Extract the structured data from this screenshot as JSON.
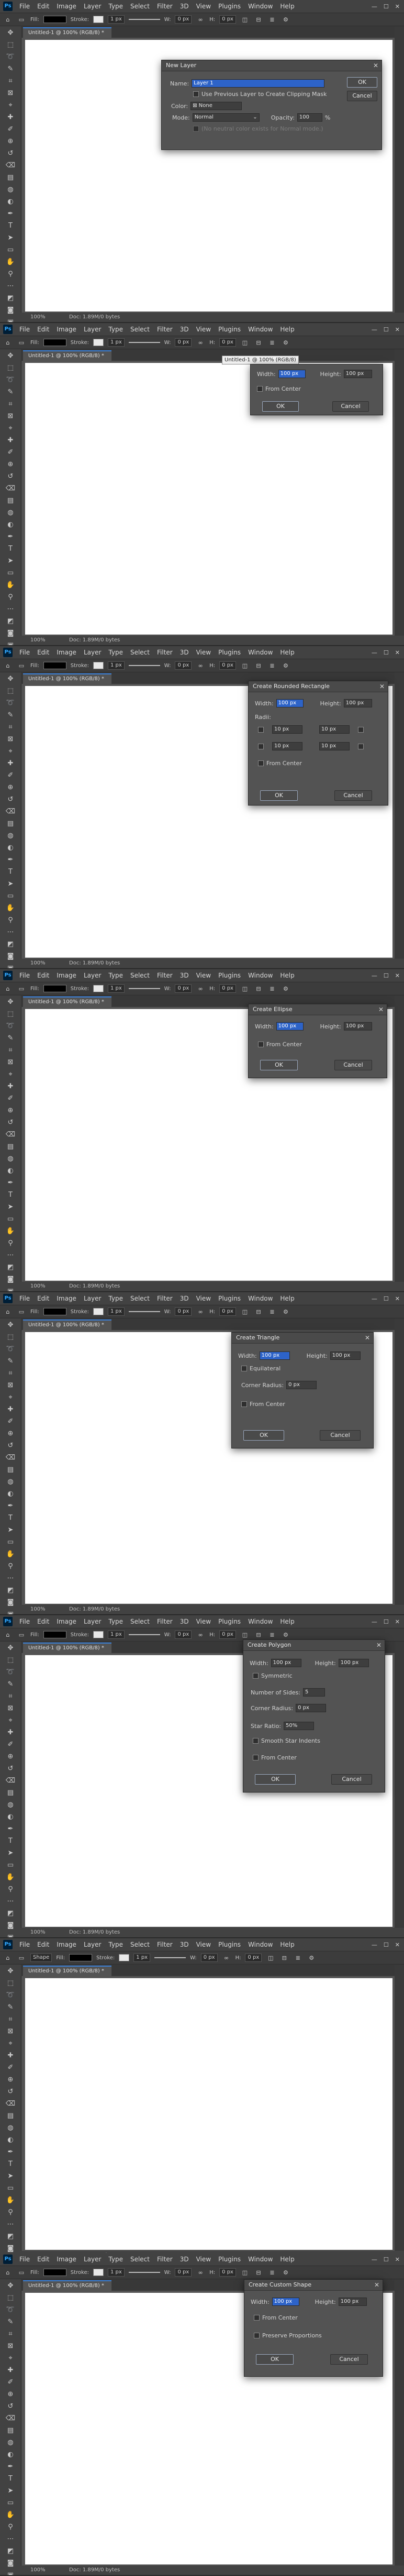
{
  "app": {
    "logo": "Ps",
    "menu": [
      "File",
      "Edit",
      "Image",
      "Layer",
      "Type",
      "Select",
      "Filter",
      "3D",
      "View",
      "Plugins",
      "Window",
      "Help"
    ],
    "doc_tab": "Untitled-1 @ 100% (RGB/8) *",
    "zoom": "100%",
    "doc_info": "Doc: 1.89M/0 bytes"
  },
  "options": {
    "fill_label": "Fill:",
    "stroke_label": "Stroke:",
    "stroke_width": "1 px",
    "w_label": "W:",
    "h_label": "H:",
    "w_value": "0 px",
    "h_value": "0 px",
    "shape_mode": "Shape"
  },
  "panels": {
    "new_layer": {
      "title": "New Layer",
      "name_label": "Name:",
      "name_value": "Layer 1",
      "clip_label": "Use Previous Layer to Create Clipping Mask",
      "color_label": "Color:",
      "color_value": "None",
      "mode_label": "Mode:",
      "mode_value": "Normal",
      "opacity_label": "Opacity:",
      "opacity_value": "100",
      "opacity_unit": "%",
      "neutral_label": "(No neutral color exists for Normal mode.)",
      "ok": "OK",
      "cancel": "Cancel"
    },
    "ellipse1": {
      "title": "Create Ellipse",
      "tooltip": "Untitled-1 @ 100% (RGB/8)",
      "width_label": "Width:",
      "width_value": "100 px",
      "height_label": "Height:",
      "height_value": "100 px",
      "center_label": "From Center",
      "ok": "OK",
      "cancel": "Cancel"
    },
    "rounded_rect": {
      "title": "Create Rounded Rectangle",
      "width_label": "Width:",
      "width_value": "100 px",
      "height_label": "Height:",
      "height_value": "100 px",
      "radii_label": "Radii:",
      "radius_tl": "10 px",
      "radius_tr": "10 px",
      "radius_bl": "10 px",
      "radius_br": "10 px",
      "center_label": "From Center",
      "ok": "OK",
      "cancel": "Cancel"
    },
    "ellipse2": {
      "title": "Create Ellipse",
      "width_label": "Width:",
      "width_value": "100 px",
      "height_label": "Height:",
      "height_value": "100 px",
      "center_label": "From Center",
      "ok": "OK",
      "cancel": "Cancel"
    },
    "triangle": {
      "title": "Create Triangle",
      "width_label": "Width:",
      "width_value": "100 px",
      "height_label": "Height:",
      "height_value": "100 px",
      "equilateral_label": "Equilateral",
      "corner_label": "Corner Radius:",
      "corner_value": "0 px",
      "center_label": "From Center",
      "ok": "OK",
      "cancel": "Cancel"
    },
    "polygon": {
      "title": "Create Polygon",
      "width_label": "Width:",
      "width_value": "100 px",
      "height_label": "Height:",
      "height_value": "100 px",
      "symmetric_label": "Symmetric",
      "sides_label": "Number of Sides:",
      "sides_value": "5",
      "corner_label": "Corner Radius:",
      "corner_value": "0 px",
      "star_label": "Star Ratio:",
      "star_value": "50%",
      "smooth_label": "Smooth Star Indents",
      "center_label": "From Center",
      "ok": "OK",
      "cancel": "Cancel"
    },
    "custom_shape": {
      "title": "Create Custom Shape",
      "width_label": "Width:",
      "width_value": "100 px",
      "height_label": "Height:",
      "height_value": "100 px",
      "center_label": "From Center",
      "proportions_label": "Preserve Proportions",
      "ok": "OK",
      "cancel": "Cancel"
    }
  },
  "icons": {
    "tools": [
      "move-icon",
      "marquee-icon",
      "lasso-icon",
      "quick-select-icon",
      "crop-icon",
      "frame-icon",
      "eyedropper-icon",
      "healing-icon",
      "brush-icon",
      "stamp-icon",
      "history-brush-icon",
      "eraser-icon",
      "gradient-icon",
      "blur-icon",
      "dodge-icon",
      "pen-icon",
      "type-icon",
      "path-select-icon",
      "shape-icon",
      "hand-icon",
      "zoom-icon",
      "more-tools-icon",
      "colors-icon",
      "quick-mask-icon",
      "screen-mode-icon"
    ],
    "glyphs": [
      "✥",
      "⬚",
      "➰",
      "✎",
      "⌗",
      "⊠",
      "⌖",
      "✚",
      "✐",
      "⊕",
      "↺",
      "⌫",
      "▤",
      "◍",
      "◐",
      "✒",
      "T",
      "➤",
      "▭",
      "✋",
      "⚲",
      "⋯",
      "◩",
      "◙",
      "▣"
    ]
  },
  "colors": {
    "accent": "#2d63c8",
    "canvas": "#ffffff",
    "ui_bg": "#535353"
  }
}
